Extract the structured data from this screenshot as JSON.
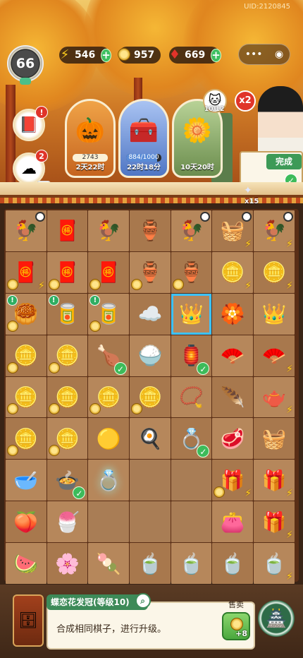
{
  "uid": "UID:2120845",
  "player_level": "66",
  "resources": {
    "energy": {
      "icon": "lightning-icon",
      "value": "546"
    },
    "coins": {
      "icon": "coin-icon",
      "value": "957"
    },
    "gems": {
      "icon": "ruby-icon",
      "value": "669"
    }
  },
  "capsule": {
    "more": "•••",
    "close": "◉"
  },
  "side_buttons": [
    {
      "name": "book",
      "icon": "book-icon",
      "badge": "!"
    },
    {
      "name": "cotton",
      "icon": "cotton-icon",
      "badge": "2"
    }
  ],
  "orders": [
    {
      "icon": "pumpkin-icon",
      "progress_text": "2743",
      "timer": "2天22时",
      "color": "#d5782b"
    },
    {
      "icon": "chest-icon",
      "progress_text": "884/1000",
      "progress": 0.884,
      "timer": "22时18分",
      "color": "#6c8fd0"
    },
    {
      "icon": "chrysanthemum-icon",
      "timer": "10天20时",
      "color": "#86a86a"
    }
  ],
  "multiplier": "x2",
  "cat_count": "10/12",
  "complete_label": "完成",
  "star_count": "x15",
  "board": {
    "rows": [
      [
        {
          "e": "🐓",
          "k": "hen-nest",
          "clock": true
        },
        {
          "e": "🧧",
          "k": "red-pouch"
        },
        {
          "e": "🐓",
          "k": "hen-nest"
        },
        {
          "e": "🏺",
          "k": "blue-pouch"
        },
        {
          "e": "🐓",
          "k": "hen-nest",
          "clock": true
        },
        {
          "e": "🧺",
          "k": "basket",
          "bolt": true,
          "clock": true
        },
        {
          "e": "🐓",
          "k": "hen-nest",
          "bolt": true,
          "clock": true
        }
      ],
      [
        {
          "e": "🧧",
          "k": "red-pouch",
          "coin": true,
          "bolt": true
        },
        {
          "e": "🧧",
          "k": "red-pouch",
          "coin": true
        },
        {
          "e": "🧧",
          "k": "red-pouch",
          "coin": true
        },
        {
          "e": "🏺",
          "k": "gold-pouch",
          "coin": true
        },
        {
          "e": "🏺",
          "k": "green-pouch",
          "coin": true
        },
        {
          "e": "🪙",
          "k": "treasure-chest",
          "bolt": true
        },
        {
          "e": "🪙",
          "k": "treasure-chest",
          "bolt": true
        }
      ],
      [
        {
          "e": "🥮",
          "k": "coin-bag",
          "coin": true,
          "alert": true
        },
        {
          "e": "🥫",
          "k": "red-tin",
          "alert": true
        },
        {
          "e": "🥫",
          "k": "green-tin",
          "coin": true,
          "alert": true
        },
        {
          "e": "☁️",
          "k": "cloud-charm"
        },
        {
          "e": "👑",
          "k": "hair-crown",
          "selected": true
        },
        {
          "e": "🏵️",
          "k": "jade-flower"
        },
        {
          "e": "👑",
          "k": "gold-crown"
        }
      ],
      [
        {
          "e": "🪙",
          "k": "coin-pile",
          "coin": true
        },
        {
          "e": "🪙",
          "k": "coin-pile",
          "coin": true
        },
        {
          "e": "🍗",
          "k": "chicken-bowl",
          "check": true
        },
        {
          "e": "🍚",
          "k": "rice-bowl"
        },
        {
          "e": "🏮",
          "k": "lantern",
          "check": true
        },
        {
          "e": "🪭",
          "k": "fan"
        },
        {
          "e": "🪭",
          "k": "fan",
          "bolt": true
        }
      ],
      [
        {
          "e": "🪙",
          "k": "coin-pile",
          "coin": true
        },
        {
          "e": "🪙",
          "k": "coin-pile",
          "coin": true
        },
        {
          "e": "🪙",
          "k": "coin-pile",
          "coin": true
        },
        {
          "e": "🪙",
          "k": "coin-pile",
          "coin": true
        },
        {
          "e": "📿",
          "k": "bead-bracelet"
        },
        {
          "e": "🪶",
          "k": "feather"
        },
        {
          "e": "🫖",
          "k": "teapot",
          "bolt": true
        }
      ],
      [
        {
          "e": "🪙",
          "k": "coin-pile",
          "coin": true
        },
        {
          "e": "🪙",
          "k": "coin-pile",
          "coin": true
        },
        {
          "e": "🟡",
          "k": "square-coin"
        },
        {
          "e": "🍳",
          "k": "fried-egg"
        },
        {
          "e": "💍",
          "k": "jade-ring",
          "check": true
        },
        {
          "e": "🥩",
          "k": "meat-basket"
        },
        {
          "e": "🧺",
          "k": "gift-basket"
        }
      ],
      [
        {
          "e": "🥣",
          "k": "soup-bowl"
        },
        {
          "e": "🍲",
          "k": "dumpling-bowl",
          "check": true
        },
        {
          "e": "💍",
          "k": "gold-ring",
          "glow": true
        },
        {
          "e": "",
          "k": "empty"
        },
        {
          "e": "",
          "k": "empty"
        },
        {
          "e": "🎁",
          "k": "gift-box",
          "coin": true,
          "bolt": true
        },
        {
          "e": "🎁",
          "k": "gift-box",
          "bolt": true
        }
      ],
      [
        {
          "e": "🍑",
          "k": "peach-bun"
        },
        {
          "e": "🍧",
          "k": "dessert-bowl"
        },
        {
          "e": "",
          "k": "empty"
        },
        {
          "e": "",
          "k": "empty"
        },
        {
          "e": "",
          "k": "empty"
        },
        {
          "e": "👛",
          "k": "silk-purse"
        },
        {
          "e": "🎁",
          "k": "gift-box",
          "bolt": true
        }
      ],
      [
        {
          "e": "🍉",
          "k": "fruit-platter"
        },
        {
          "e": "🌸",
          "k": "flower-cakes"
        },
        {
          "e": "🍡",
          "k": "pink-cake"
        },
        {
          "e": "🍵",
          "k": "tea-cup"
        },
        {
          "e": "🍵",
          "k": "tea-cup-green"
        },
        {
          "e": "🍵",
          "k": "tea-bowl"
        },
        {
          "e": "🍵",
          "k": "tea-set",
          "bolt": true
        }
      ]
    ]
  },
  "info_panel": {
    "title": "蝶恋花发冠(等级10)",
    "description": "合成相同棋子，进行升级。",
    "sell_label": "售卖",
    "sell_value": "+8"
  }
}
